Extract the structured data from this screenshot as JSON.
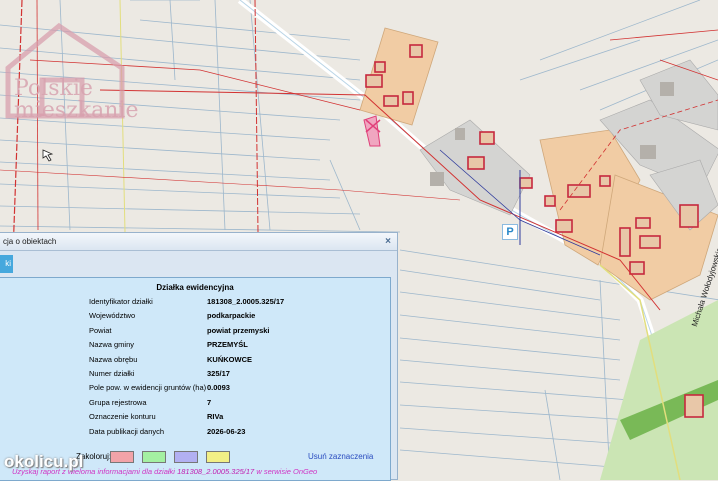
{
  "logo": {
    "line1": "Polskie",
    "line2": "mieszkanie"
  },
  "watermark": "okolicu.pl",
  "map": {
    "street_name": "Michała Wołodyjowskiego",
    "parking_label": "P"
  },
  "panel": {
    "header_title": "cja o obiektach",
    "close_symbol": "×",
    "tab_label": "ki",
    "title": "Działka ewidencyjna",
    "rows": [
      {
        "label": "Identyfikator działki",
        "value": "181308_2.0005.325/17"
      },
      {
        "label": "Województwo",
        "value": "podkarpackie"
      },
      {
        "label": "Powiat",
        "value": "powiat przemyski"
      },
      {
        "label": "Nazwa gminy",
        "value": "PRZEMYŚL"
      },
      {
        "label": "Nazwa obrębu",
        "value": "KUŃKOWCE"
      },
      {
        "label": "Numer działki",
        "value": "325/17"
      },
      {
        "label": "Pole pow. w ewidencji gruntów (ha)",
        "value": "0.0093"
      },
      {
        "label": "Grupa rejestrowa",
        "value": "7"
      },
      {
        "label": "Oznaczenie konturu",
        "value": "RIVa"
      },
      {
        "label": "Data publikacji danych",
        "value": "2026-06-23"
      }
    ],
    "colors_label": "Zakoloruj:",
    "swatches": [
      "#f2a3a8",
      "#a4f0a2",
      "#b2b0f2",
      "#f2ef86"
    ],
    "clear_label": "Usuń zaznaczenia",
    "report_prefix": "Uzyskaj raport z wieloma informacjami dla działki",
    "report_id": "181308_2.0005.325/17",
    "report_suffix": "w serwisie OnGeo"
  }
}
